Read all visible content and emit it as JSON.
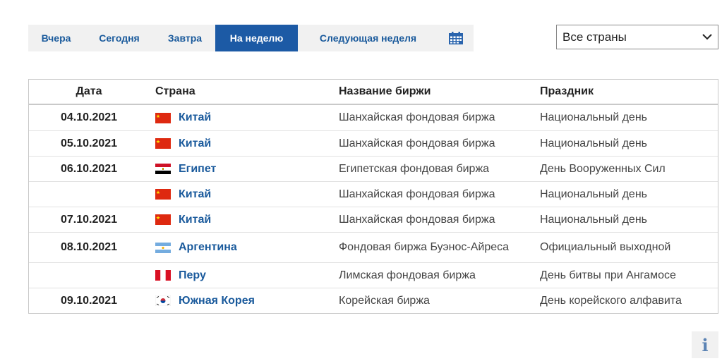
{
  "tabs": [
    {
      "label": "Вчера",
      "active": false
    },
    {
      "label": "Сегодня",
      "active": false
    },
    {
      "label": "Завтра",
      "active": false
    },
    {
      "label": "На неделю",
      "active": true
    },
    {
      "label": "Следующая неделя",
      "active": false
    }
  ],
  "calendar_icon": "calendar-icon",
  "country_filter": {
    "selected": "Все страны"
  },
  "table": {
    "headers": {
      "date": "Дата",
      "country": "Страна",
      "exchange": "Название биржи",
      "holiday": "Праздник"
    },
    "rows": [
      {
        "date": "04.10.2021",
        "country": "Китай",
        "flag": "china",
        "exchange": "Шанхайская фондовая биржа",
        "holiday": "Национальный день"
      },
      {
        "date": "05.10.2021",
        "country": "Китай",
        "flag": "china",
        "exchange": "Шанхайская фондовая биржа",
        "holiday": "Национальный день"
      },
      {
        "date": "06.10.2021",
        "country": "Египет",
        "flag": "egypt",
        "exchange": "Египетская фондовая биржа",
        "holiday": "День Вооруженных Сил"
      },
      {
        "date": "",
        "country": "Китай",
        "flag": "china",
        "exchange": "Шанхайская фондовая биржа",
        "holiday": "Национальный день"
      },
      {
        "date": "07.10.2021",
        "country": "Китай",
        "flag": "china",
        "exchange": "Шанхайская фондовая биржа",
        "holiday": "Национальный день"
      },
      {
        "date": "08.10.2021",
        "country": "Аргентина",
        "flag": "argentina",
        "exchange": "Фондовая биржа Буэнос-Айреса",
        "holiday": "Официальный выходной"
      },
      {
        "date": "",
        "country": "Перу",
        "flag": "peru",
        "exchange": "Лимская фондовая биржа",
        "holiday": "День битвы при Ангамосе"
      },
      {
        "date": "09.10.2021",
        "country": "Южная Корея",
        "flag": "south-korea",
        "exchange": "Корейская биржа",
        "holiday": "День корейского алфавита"
      }
    ]
  },
  "info_button": {
    "label": "i"
  },
  "colors": {
    "accent": "#1c5aa5",
    "link": "#1a5a9c",
    "tab_bg": "#f1f1f1"
  }
}
